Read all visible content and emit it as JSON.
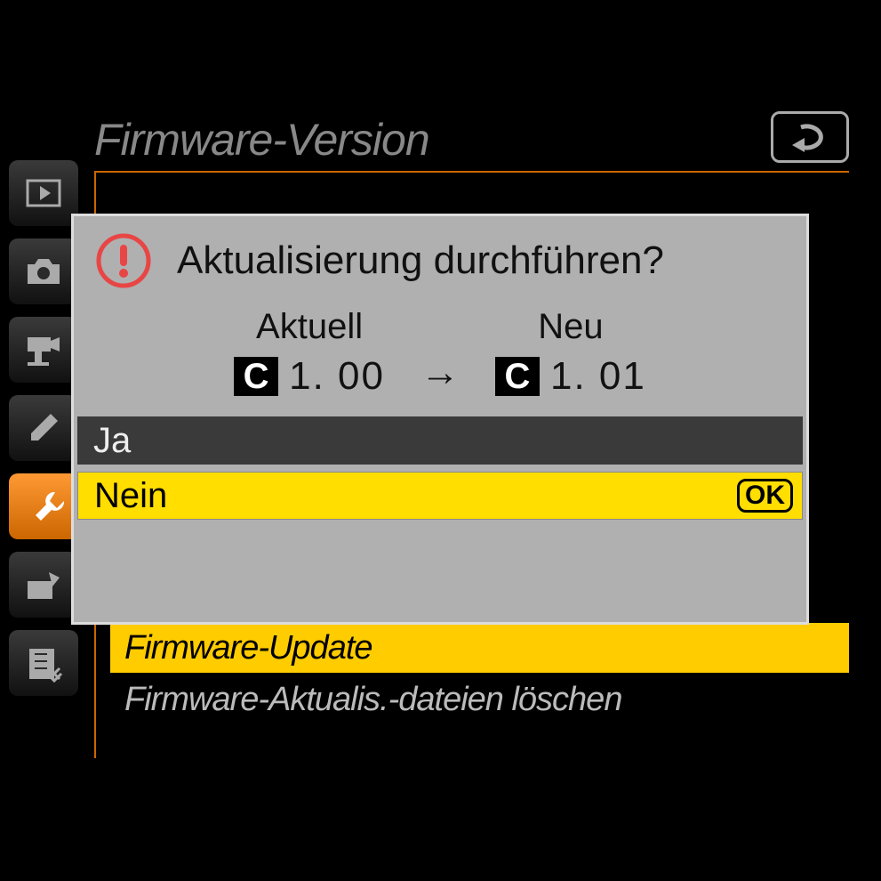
{
  "header": {
    "title": "Firmware-Version"
  },
  "sidebar": {
    "tabs": [
      "playback",
      "photo",
      "video",
      "pencil",
      "setup",
      "retouch",
      "mymenu"
    ],
    "active_index": 4
  },
  "background_menu": {
    "highlighted": "Firmware-Update",
    "normal": "Firmware-Aktualis.-dateien löschen"
  },
  "dialog": {
    "title": "Aktualisierung durchführen?",
    "current_label": "Aktuell",
    "new_label": "Neu",
    "badge": "C",
    "current_version": "1. 00",
    "new_version": "1. 01",
    "arrow": "→",
    "option_yes": "Ja",
    "option_no": "Nein",
    "ok_label": "OK"
  }
}
